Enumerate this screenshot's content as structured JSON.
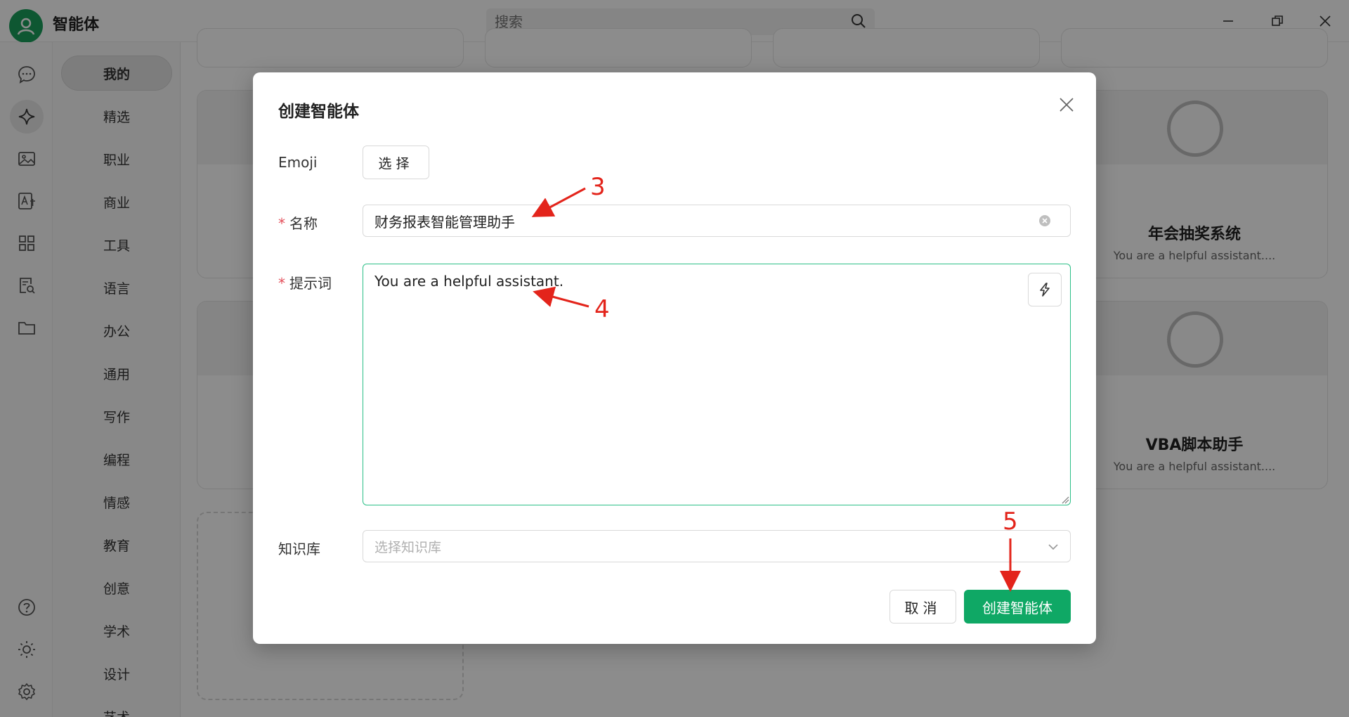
{
  "app": {
    "title": "智能体"
  },
  "search": {
    "placeholder": "搜索"
  },
  "categories": [
    "我的",
    "精选",
    "职业",
    "商业",
    "工具",
    "语言",
    "办公",
    "通用",
    "写作",
    "编程",
    "情感",
    "教育",
    "创意",
    "学术",
    "设计",
    "艺术"
  ],
  "cards": [
    {
      "name": "年会抽奖系统",
      "desc": "You are a helpful assistant...."
    },
    {
      "name": "VBA脚本助手",
      "desc": "You are a helpful assistant...."
    }
  ],
  "modal": {
    "title": "创建智能体",
    "emoji_label": "Emoji",
    "choose_button": "选择",
    "name_label": "名称",
    "name_value": "财务报表智能管理助手",
    "prompt_label": "提示词",
    "prompt_value": "You are a helpful assistant.",
    "kb_label": "知识库",
    "kb_placeholder": "选择知识库",
    "cancel_button": "取消",
    "create_button": "创建智能体"
  },
  "annotations": [
    "3",
    "4",
    "5"
  ],
  "colors": {
    "accent": "#0fa865",
    "annotation": "#e3241b",
    "focus_border": "#2bbf86"
  }
}
